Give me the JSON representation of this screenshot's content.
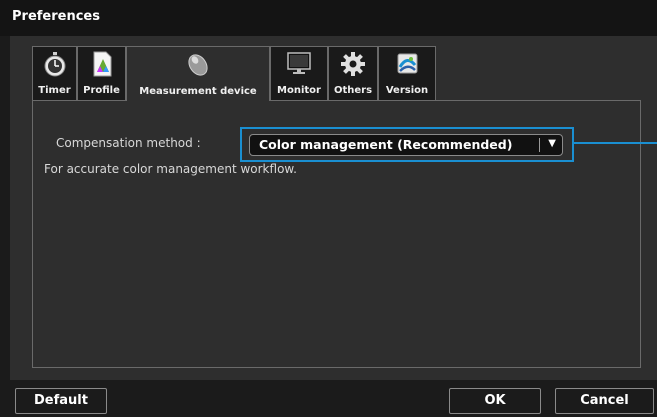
{
  "window": {
    "title": "Preferences"
  },
  "tabs": [
    {
      "label": "Timer",
      "icon": "stopwatch-icon"
    },
    {
      "label": "Profile",
      "icon": "profile-icon"
    },
    {
      "label": "Measurement device",
      "icon": "measurement-device-icon",
      "active": true
    },
    {
      "label": "Monitor",
      "icon": "monitor-icon"
    },
    {
      "label": "Others",
      "icon": "gear-icon"
    },
    {
      "label": "Version",
      "icon": "version-icon"
    }
  ],
  "compensation": {
    "label": "Compensation method :",
    "selected": "Color management (Recommended)",
    "description": "For accurate color management workflow."
  },
  "buttons": {
    "default": "Default",
    "ok": "OK",
    "cancel": "Cancel"
  },
  "colors": {
    "highlight": "#1a8fd1",
    "background": "#2e2e2e",
    "titlebar": "#141414"
  }
}
